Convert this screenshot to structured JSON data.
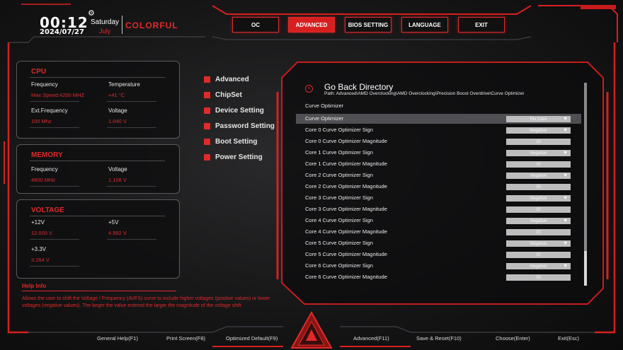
{
  "header": {
    "time": "00:12",
    "date": "2024/07/27",
    "weekday": "Saturday",
    "month": "July",
    "brand": "COLORFUL",
    "gear_icon": "⚙",
    "tabs": [
      "OC",
      "ADVANCED",
      "BIOS SETTING",
      "LANGUAGE",
      "EXIT"
    ],
    "active_tab": "ADVANCED"
  },
  "cpu": {
    "title": "CPU",
    "frequency_label": "Frequency",
    "frequency_value": "Max Speed:4200 MHZ",
    "temperature_label": "Temperature",
    "temperature_value": "+41 °C",
    "ext_frequency_label": "Ext.Frequency",
    "ext_frequency_value": "100 Mhz",
    "voltage_label": "Voltage",
    "voltage_value": "1.040 V"
  },
  "memory": {
    "title": "MEMORY",
    "frequency_label": "Frequency",
    "frequency_value": "4800 MHz",
    "voltage_label": "Voltage",
    "voltage_value": "1.108 V"
  },
  "voltage": {
    "title": "VOLTAGE",
    "v12_label": "+12V",
    "v12_value": "12.000 V",
    "v5_label": "+5V",
    "v5_value": "4.992 V",
    "v33_label": "+3.3V",
    "v33_value": "3.264 V"
  },
  "menu": [
    "Advanced",
    "ChipSet",
    "Device Setting",
    "Password Setting",
    "Boot Setting",
    "Power Setting"
  ],
  "main": {
    "back_icon": "back-arrow-icon",
    "back_title": "Go Back Directory",
    "path": "Path: Advanced\\AMD Overclocking\\AMD Overclocking\\Precision Boost Overdrive\\Curve Optimizer",
    "section_title": "Curve Optimizer",
    "rows": [
      {
        "label": "Curve Optimizer",
        "value": "Per Core",
        "dropdown": true
      },
      {
        "label": "Core 0 Curve Optimizer Sign",
        "value": "Negative",
        "dropdown": true
      },
      {
        "label": "Core 0 Curve Optimizer Magnitude",
        "value": "30",
        "dropdown": false
      },
      {
        "label": "Core 1 Curve Optimizer Sign",
        "value": "Negative",
        "dropdown": true
      },
      {
        "label": "Core 1 Curve Optimizer Magnitude",
        "value": "30",
        "dropdown": false
      },
      {
        "label": "Core 2 Curve Optimizer Sign",
        "value": "Negative",
        "dropdown": true
      },
      {
        "label": "Core 2 Curve Optimizer Magnitude",
        "value": "30",
        "dropdown": false
      },
      {
        "label": "Core 3 Curve Optimizer Sign",
        "value": "Negative",
        "dropdown": true
      },
      {
        "label": "Core 3 Curve Optimizer Magnitude",
        "value": "30",
        "dropdown": false
      },
      {
        "label": "Core 4 Curve Optimizer Sign",
        "value": "Negative",
        "dropdown": true
      },
      {
        "label": "Core 4 Curve Optimizer Magnitude",
        "value": "30",
        "dropdown": false
      },
      {
        "label": "Core 5 Curve Optimizer Sign",
        "value": "Negative",
        "dropdown": true
      },
      {
        "label": "Core 5 Curve Optimizer Magnitude",
        "value": "30",
        "dropdown": false
      },
      {
        "label": "Core 6 Curve Optimizer Sign",
        "value": "Negative",
        "dropdown": true
      },
      {
        "label": "Core 6 Curve Optimizer Magnitude",
        "value": "30",
        "dropdown": false
      }
    ],
    "selected_row": 0,
    "dropdown_arrow": "▼"
  },
  "help": {
    "title": "Help Info",
    "text": "Allows the user to shift the Voltage / Frequency (AVFS) curve to include higher voltages (positive values) or lower voltages (negative values). The larger the value entered the larger the magnitude of the voltage shift"
  },
  "footer": [
    "General Help(F1)",
    "Print Screen(F8)",
    "Optimized Default(F9)",
    "Advanced(F11)",
    "Save & Reset(F10)",
    "Choose(Enter)",
    "Exit(Esc)"
  ],
  "colors": {
    "accent": "#e02a2a",
    "panel_border": "#5a5a5e",
    "value_box": "#bdbdbd",
    "selected_row": "#505054"
  }
}
